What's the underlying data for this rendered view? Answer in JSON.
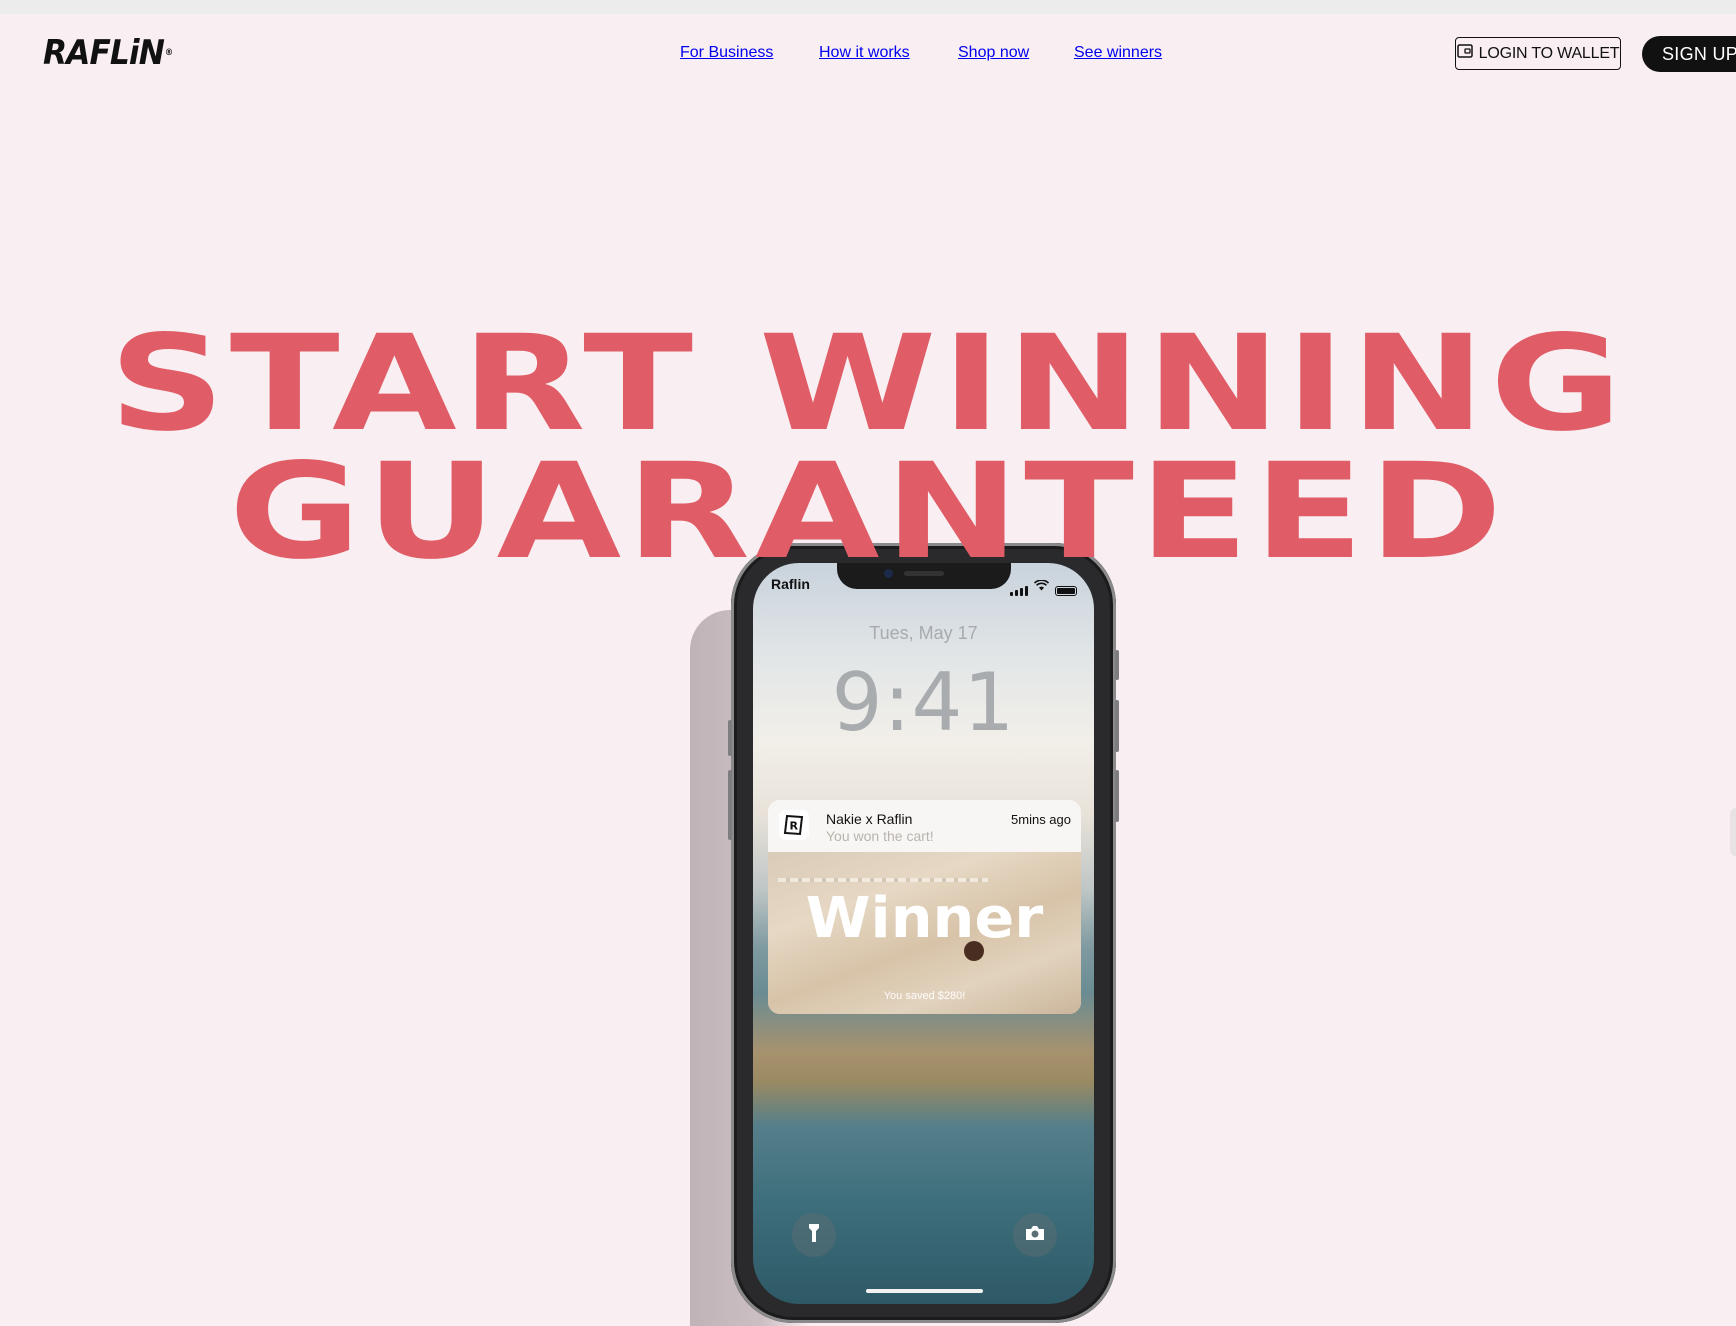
{
  "brand": {
    "logo_text": "RAFLiN",
    "logo_mark": "®"
  },
  "nav": {
    "items": [
      {
        "label": "For Business"
      },
      {
        "label": "How it works"
      },
      {
        "label": "Shop now"
      },
      {
        "label": "See winners"
      }
    ]
  },
  "header_actions": {
    "login_label": "LOGIN TO WALLET",
    "signup_label": "SIGN UP"
  },
  "hero": {
    "line1": "START WINNING",
    "line2": "GUARANTEED",
    "accent_color": "#e05c66"
  },
  "phone": {
    "carrier": "Raflin",
    "date": "Tues, May 17",
    "time": "9:41",
    "notification": {
      "title": "Nakie x Raflin",
      "subtitle": "You won the cart!",
      "time_ago": "5mins ago",
      "image_heading": "Winner",
      "image_caption": "You saved $280!"
    },
    "icons": [
      "flashlight-icon",
      "camera-icon"
    ]
  }
}
